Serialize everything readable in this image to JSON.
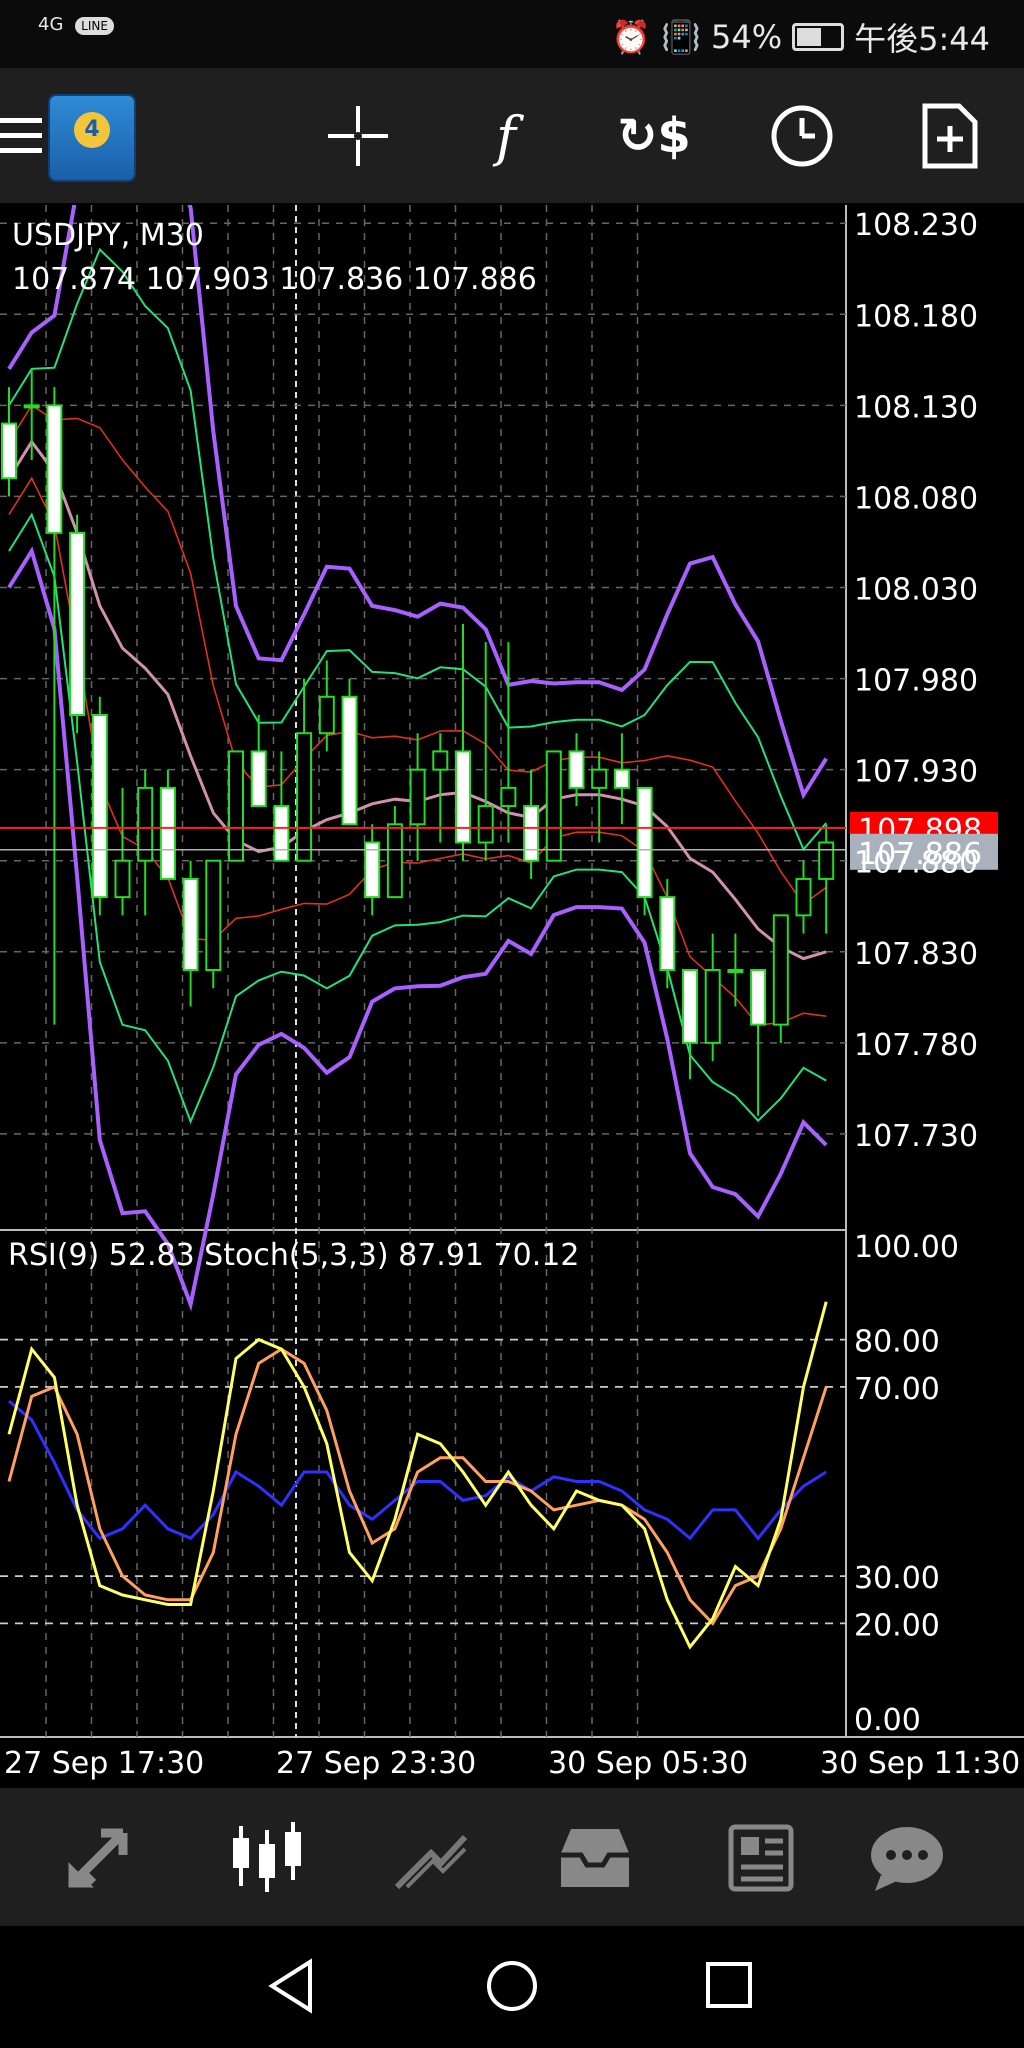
{
  "status_bar": {
    "network": "4G",
    "app_badge": "LINE",
    "battery": "54%",
    "time": "午後5:44"
  },
  "main_chart": {
    "symbol_line": "USDJPY, M30",
    "ohlc_line": "107.874 107.903 107.836 107.886",
    "price_ticks": [
      "108.230",
      "108.180",
      "108.130",
      "108.080",
      "108.030",
      "107.980",
      "107.930",
      "107.880",
      "107.830",
      "107.780",
      "107.730"
    ],
    "price_label_red": "107.898",
    "price_label_grey": "107.886"
  },
  "indicator": {
    "label": "RSI(9) 52.83 Stoch(5,3,3) 87.91 70.12",
    "ticks": [
      "100.00",
      "80.00",
      "70.00",
      "30.00",
      "20.00",
      "0.00"
    ]
  },
  "time_axis": [
    "27 Sep 17:30",
    "27 Sep 23:30",
    "30 Sep 05:30",
    "30 Sep 11:30"
  ],
  "colors": {
    "background": "#000000",
    "bull_fill": "#ffffff",
    "candle_outline": "#22dd22",
    "bb_inner": "#e03020",
    "bb_mid": "#22e07a",
    "bb_outer": "#a860ff",
    "ma": "#d090b0",
    "rsi": "#3030ff",
    "stoch_main": "#ffff66",
    "stoch_signal": "#ffa060",
    "bid_line": "#ff2020",
    "ask_line": "#b0b0b0"
  },
  "chart_data": {
    "type": "candlestick",
    "symbol": "USDJPY",
    "timeframe": "M30",
    "ylim": [
      107.68,
      108.24
    ],
    "candles": [
      {
        "o": 108.12,
        "h": 108.14,
        "l": 108.08,
        "c": 108.09
      },
      {
        "o": 108.13,
        "h": 108.15,
        "l": 108.1,
        "c": 108.13
      },
      {
        "o": 108.13,
        "h": 108.14,
        "l": 107.79,
        "c": 108.06
      },
      {
        "o": 108.06,
        "h": 108.07,
        "l": 107.95,
        "c": 107.96
      },
      {
        "o": 107.96,
        "h": 107.97,
        "l": 107.85,
        "c": 107.86
      },
      {
        "o": 107.86,
        "h": 107.92,
        "l": 107.85,
        "c": 107.88
      },
      {
        "o": 107.88,
        "h": 107.93,
        "l": 107.85,
        "c": 107.92
      },
      {
        "o": 107.92,
        "h": 107.93,
        "l": 107.87,
        "c": 107.87
      },
      {
        "o": 107.87,
        "h": 107.88,
        "l": 107.8,
        "c": 107.82
      },
      {
        "o": 107.82,
        "h": 107.88,
        "l": 107.81,
        "c": 107.88
      },
      {
        "o": 107.88,
        "h": 107.94,
        "l": 107.88,
        "c": 107.94
      },
      {
        "o": 107.94,
        "h": 107.96,
        "l": 107.91,
        "c": 107.91
      },
      {
        "o": 107.91,
        "h": 107.94,
        "l": 107.88,
        "c": 107.88
      },
      {
        "o": 107.88,
        "h": 107.98,
        "l": 107.88,
        "c": 107.95
      },
      {
        "o": 107.95,
        "h": 107.99,
        "l": 107.94,
        "c": 107.97
      },
      {
        "o": 107.97,
        "h": 107.98,
        "l": 107.9,
        "c": 107.9
      },
      {
        "o": 107.89,
        "h": 107.9,
        "l": 107.85,
        "c": 107.86
      },
      {
        "o": 107.86,
        "h": 107.91,
        "l": 107.86,
        "c": 107.9
      },
      {
        "o": 107.9,
        "h": 107.95,
        "l": 107.88,
        "c": 107.93
      },
      {
        "o": 107.93,
        "h": 107.95,
        "l": 107.89,
        "c": 107.94
      },
      {
        "o": 107.94,
        "h": 108.01,
        "l": 107.88,
        "c": 107.89
      },
      {
        "o": 107.89,
        "h": 108.0,
        "l": 107.88,
        "c": 107.91
      },
      {
        "o": 107.91,
        "h": 108.0,
        "l": 107.89,
        "c": 107.92
      },
      {
        "o": 107.91,
        "h": 107.93,
        "l": 107.87,
        "c": 107.88
      },
      {
        "o": 107.88,
        "h": 107.94,
        "l": 107.88,
        "c": 107.94
      },
      {
        "o": 107.94,
        "h": 107.95,
        "l": 107.91,
        "c": 107.92
      },
      {
        "o": 107.92,
        "h": 107.94,
        "l": 107.89,
        "c": 107.93
      },
      {
        "o": 107.93,
        "h": 107.95,
        "l": 107.9,
        "c": 107.92
      },
      {
        "o": 107.92,
        "h": 107.92,
        "l": 107.85,
        "c": 107.86
      },
      {
        "o": 107.86,
        "h": 107.87,
        "l": 107.81,
        "c": 107.82
      },
      {
        "o": 107.82,
        "h": 107.82,
        "l": 107.76,
        "c": 107.78
      },
      {
        "o": 107.78,
        "h": 107.84,
        "l": 107.77,
        "c": 107.82
      },
      {
        "o": 107.82,
        "h": 107.84,
        "l": 107.8,
        "c": 107.82
      },
      {
        "o": 107.82,
        "h": 107.82,
        "l": 107.74,
        "c": 107.79
      },
      {
        "o": 107.79,
        "h": 107.85,
        "l": 107.78,
        "c": 107.85
      },
      {
        "o": 107.85,
        "h": 107.88,
        "l": 107.84,
        "c": 107.87
      },
      {
        "o": 107.87,
        "h": 107.9,
        "l": 107.84,
        "c": 107.89
      }
    ],
    "indicators": [
      {
        "name": "RSI(9)",
        "value": 52.83
      },
      {
        "name": "Stoch(5,3,3)",
        "main": 87.91,
        "signal": 70.12
      }
    ],
    "rsi_range": [
      0,
      100
    ],
    "rsi_levels": [
      80,
      70,
      30,
      20
    ],
    "rsi": [
      67,
      63,
      54,
      44,
      38,
      40,
      45,
      40,
      38,
      43,
      52,
      49,
      45,
      52,
      52,
      45,
      42,
      46,
      50,
      50,
      46,
      47,
      51,
      48,
      51,
      50,
      50,
      48,
      44,
      42,
      38,
      44,
      44,
      38,
      44,
      49,
      52
    ],
    "stoch_main": [
      60,
      78,
      72,
      45,
      28,
      26,
      25,
      24,
      24,
      48,
      76,
      80,
      78,
      70,
      58,
      35,
      29,
      42,
      60,
      58,
      52,
      45,
      52,
      45,
      40,
      48,
      46,
      45,
      40,
      25,
      15,
      21,
      32,
      28,
      42,
      70,
      88
    ],
    "stoch_signal": [
      50,
      68,
      70,
      60,
      40,
      30,
      26,
      25,
      25,
      35,
      60,
      75,
      78,
      75,
      65,
      48,
      37,
      40,
      52,
      55,
      55,
      50,
      50,
      48,
      44,
      45,
      46,
      45,
      42,
      35,
      25,
      20,
      28,
      30,
      40,
      55,
      70
    ]
  }
}
